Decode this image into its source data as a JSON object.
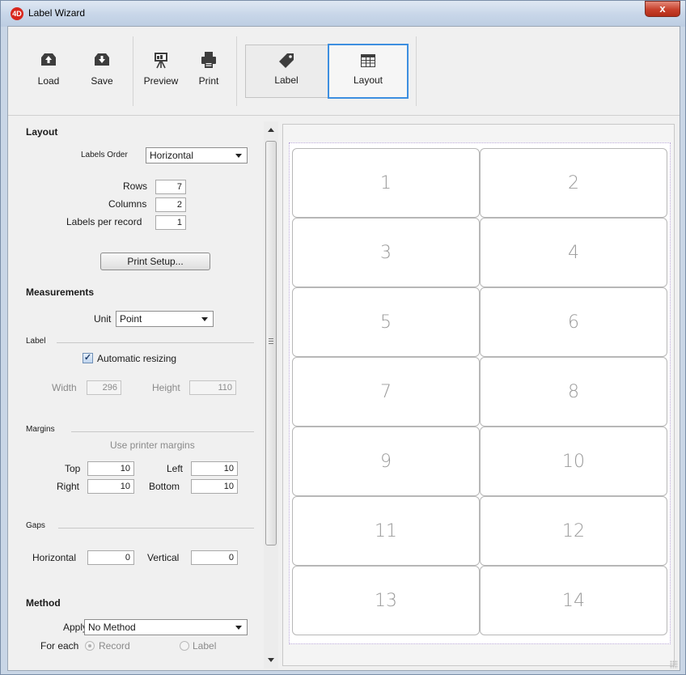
{
  "window": {
    "title": "Label Wizard",
    "app_icon_text": "4D",
    "close_symbol": "x"
  },
  "toolbar": {
    "load_label": "Load",
    "save_label": "Save",
    "preview_label": "Preview",
    "print_label": "Print",
    "tabs": [
      {
        "label": "Label",
        "icon": "tag-icon",
        "selected": false
      },
      {
        "label": "Layout",
        "icon": "grid-icon",
        "selected": true
      }
    ]
  },
  "layout_section": {
    "title": "Layout",
    "labels_order_label": "Labels Order",
    "labels_order_value": "Horizontal",
    "rows_label": "Rows",
    "rows_value": "7",
    "columns_label": "Columns",
    "columns_value": "2",
    "labels_per_record_label": "Labels per record",
    "labels_per_record_value": "1",
    "print_setup_label": "Print Setup..."
  },
  "measurements": {
    "title": "Measurements",
    "unit_label": "Unit",
    "unit_value": "Point",
    "label_group": "Label",
    "automatic_resizing_label": "Automatic resizing",
    "automatic_resizing_checked": true,
    "width_label": "Width",
    "width_value": "296",
    "height_label": "Height",
    "height_value": "110",
    "margins_group": "Margins",
    "use_printer_margins_label": "Use printer margins",
    "top_label": "Top",
    "top_value": "10",
    "left_label": "Left",
    "left_value": "10",
    "right_label": "Right",
    "right_value": "10",
    "bottom_label": "Bottom",
    "bottom_value": "10",
    "gaps_group": "Gaps",
    "horizontal_label": "Horizontal",
    "horizontal_value": "0",
    "vertical_label": "Vertical",
    "vertical_value": "0"
  },
  "method": {
    "title": "Method",
    "apply_label": "Apply",
    "apply_value": "No Method",
    "for_each_label": "For each",
    "record_label": "Record",
    "label_option_label": "Label"
  },
  "preview": {
    "cells": [
      "1",
      "2",
      "3",
      "4",
      "5",
      "6",
      "7",
      "8",
      "9",
      "10",
      "11",
      "12",
      "13",
      "14"
    ]
  },
  "colors": {
    "selection_accent": "#3d8fe0",
    "cell_text": "#9a9a9a"
  }
}
